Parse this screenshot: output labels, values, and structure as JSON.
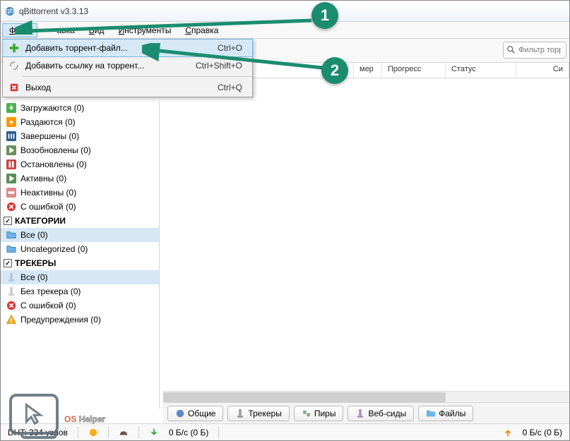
{
  "title": "qBittorrent v3.3.13",
  "menubar": {
    "file": "Файл",
    "edit": "авка",
    "view": "Вид",
    "tools": "Инструменты",
    "help": "Справка"
  },
  "dropdown": {
    "add_file": "Добавить торрент-файл...",
    "add_file_sc": "Ctrl+O",
    "add_link": "Добавить ссылку на торрент...",
    "add_link_sc": "Ctrl+Shift+O",
    "exit": "Выход",
    "exit_sc": "Ctrl+Q"
  },
  "search": {
    "placeholder": "Фильтр торре"
  },
  "columns": {
    "size": "мер",
    "progress": "Прогресс",
    "status": "Статус",
    "seeds": "Си"
  },
  "sidebar": {
    "downloading": "Загружаются (0)",
    "seeding": "Раздаются (0)",
    "completed": "Завершены (0)",
    "resumed": "Возобновлены (0)",
    "paused": "Остановлены (0)",
    "active": "Активны (0)",
    "inactive": "Неактивны (0)",
    "errored": "С ошибкой (0)",
    "categories_header": "КАТЕГОРИИ",
    "cat_all": "Все (0)",
    "cat_uncat": "Uncategorized (0)",
    "trackers_header": "ТРЕКЕРЫ",
    "trk_all": "Все (0)",
    "trk_notracker": "Без трекера (0)",
    "trk_error": "С ошибкой (0)",
    "trk_warn": "Предупреждения (0)"
  },
  "bottom_tabs": {
    "general": "Общие",
    "trackers": "Трекеры",
    "peers": "Пиры",
    "webseeds": "Веб-сиды",
    "files": "Файлы"
  },
  "status": {
    "dht": "DHT: 334 узлов",
    "down": "0 Б/с (0 Б)",
    "up": "0 Б/с (0 Б)"
  },
  "callouts": {
    "one": "1",
    "two": "2"
  },
  "watermark": {
    "os": "OS",
    "helper": "Helper"
  }
}
